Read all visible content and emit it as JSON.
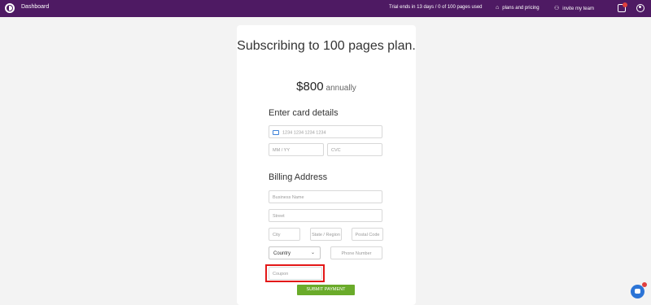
{
  "topbar": {
    "dashboard": "Dashboard",
    "trial": "Trial ends in 13 days / 0 of 100 pages used",
    "plans": "plans and pricing",
    "invite": "invite my team",
    "icons": [
      "app-logo-icon",
      "tag-icon",
      "team-icon",
      "gift-icon",
      "user-icon"
    ]
  },
  "checkout": {
    "title": "Subscribing to 100 pages plan.",
    "price": "$800",
    "period": "annually",
    "card_heading": "Enter card details",
    "card_number_placeholder": "1234 1234 1234 1234",
    "expiry_placeholder": "MM / YY",
    "cvc_placeholder": "CVC",
    "billing_heading": "Billing Address",
    "business_placeholder": "Business Name",
    "street_placeholder": "Street",
    "city_placeholder": "City",
    "state_placeholder": "State / Region",
    "postal_placeholder": "Postal Code",
    "country_value": "Country",
    "phone_placeholder": "Phone Number",
    "coupon_placeholder": "Coupon",
    "submit_label": "SUBMIT PAYMENT"
  },
  "colors": {
    "topbar": "#4e1a63",
    "submit": "#6aab2a",
    "highlight": "#e31818",
    "chat": "#2c74d6"
  }
}
